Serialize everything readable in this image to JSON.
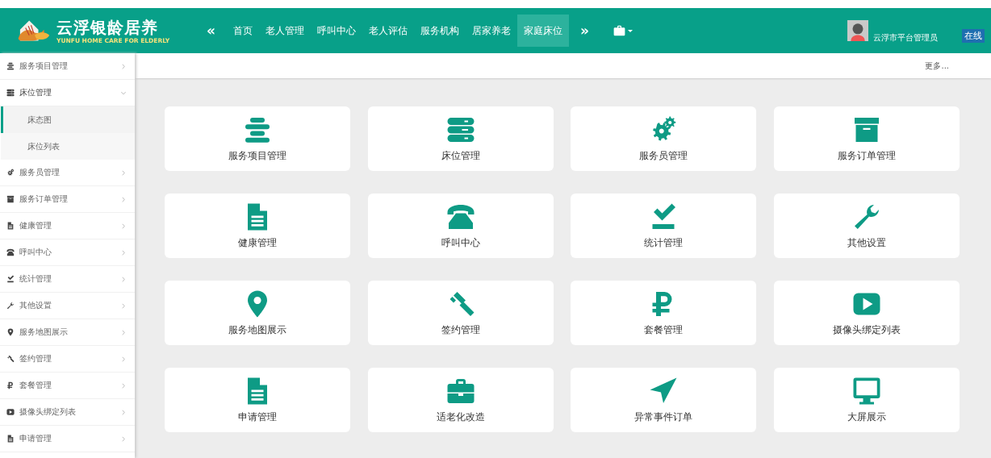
{
  "header": {
    "logo_title": "云浮银龄居养",
    "logo_subtitle": "YUNFU HOME CARE FOR ELDERLY",
    "nav_prev": "«",
    "nav_next": "»",
    "nav": [
      {
        "label": "首页",
        "selected": false
      },
      {
        "label": "老人管理",
        "selected": false
      },
      {
        "label": "呼叫中心",
        "selected": false
      },
      {
        "label": "老人评估",
        "selected": false
      },
      {
        "label": "服务机构",
        "selected": false
      },
      {
        "label": "居家养老",
        "selected": false
      },
      {
        "label": "家庭床位",
        "selected": true
      }
    ],
    "user": "云浮市平台管理员",
    "status": "在线"
  },
  "sidebar": {
    "items": [
      {
        "label": "服务项目管理",
        "kind": "list",
        "expanded": false
      },
      {
        "label": "床位管理",
        "kind": "server",
        "expanded": true,
        "children": [
          {
            "label": "床态图",
            "selected": true
          },
          {
            "label": "床位列表",
            "selected": false
          }
        ]
      },
      {
        "label": "服务员管理",
        "kind": "gears",
        "expanded": false
      },
      {
        "label": "服务订单管理",
        "kind": "archive",
        "expanded": false
      },
      {
        "label": "健康管理",
        "kind": "file",
        "expanded": false
      },
      {
        "label": "呼叫中心",
        "kind": "phone",
        "expanded": false
      },
      {
        "label": "统计管理",
        "kind": "check",
        "expanded": false
      },
      {
        "label": "其他设置",
        "kind": "wrench",
        "expanded": false
      },
      {
        "label": "服务地图展示",
        "kind": "marker",
        "expanded": false
      },
      {
        "label": "签约管理",
        "kind": "gavel",
        "expanded": false
      },
      {
        "label": "套餐管理",
        "kind": "ruble",
        "expanded": false
      },
      {
        "label": "摄像头绑定列表",
        "kind": "play",
        "expanded": false
      },
      {
        "label": "申请管理",
        "kind": "file",
        "expanded": false
      }
    ]
  },
  "toolbar": {
    "more": "更多..."
  },
  "tiles": [
    {
      "label": "服务项目管理",
      "kind": "list"
    },
    {
      "label": "床位管理",
      "kind": "server"
    },
    {
      "label": "服务员管理",
      "kind": "gears"
    },
    {
      "label": "服务订单管理",
      "kind": "archive"
    },
    {
      "label": "健康管理",
      "kind": "file"
    },
    {
      "label": "呼叫中心",
      "kind": "phone"
    },
    {
      "label": "统计管理",
      "kind": "check"
    },
    {
      "label": "其他设置",
      "kind": "wrench"
    },
    {
      "label": "服务地图展示",
      "kind": "marker"
    },
    {
      "label": "签约管理",
      "kind": "gavel"
    },
    {
      "label": "套餐管理",
      "kind": "ruble"
    },
    {
      "label": "摄像头绑定列表",
      "kind": "play"
    },
    {
      "label": "申请管理",
      "kind": "file"
    },
    {
      "label": "适老化改造",
      "kind": "briefcase"
    },
    {
      "label": "异常事件订单",
      "kind": "plane"
    },
    {
      "label": "大屏展示",
      "kind": "monitor"
    }
  ]
}
